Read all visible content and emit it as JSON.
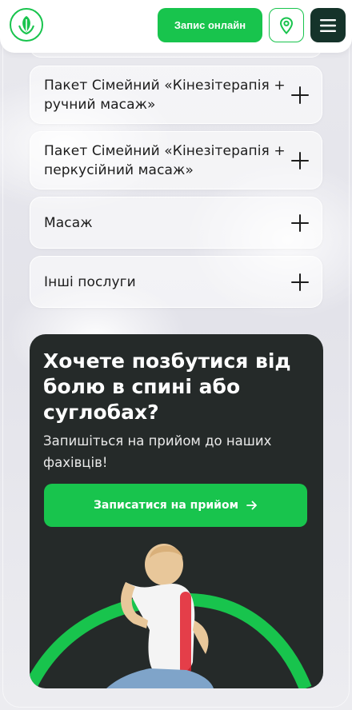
{
  "header": {
    "book_online_label": "Запис онлайн",
    "logo_icon": "leaf-logo-icon",
    "location_icon": "location-pin-icon",
    "menu_icon": "hamburger-menu-icon"
  },
  "services": [
    {
      "label": "Пакет Сімейний «Кінезітерапія + ручний масаж»"
    },
    {
      "label": "Пакет Сімейний «Кінезітерапія + перкусійний масаж»"
    },
    {
      "label": "Масаж"
    },
    {
      "label": "Інші послуги"
    }
  ],
  "cta": {
    "title": "Хочете позбутися від болю в спині або суглобах?",
    "subtitle": "Запишіться на прийом до наших фахівців!",
    "button_label": "Записатися на прийом",
    "button_icon": "arrow-right-icon"
  },
  "colors": {
    "accent": "#18c44d",
    "dark": "#15332a",
    "card_dark": "#252a29"
  }
}
